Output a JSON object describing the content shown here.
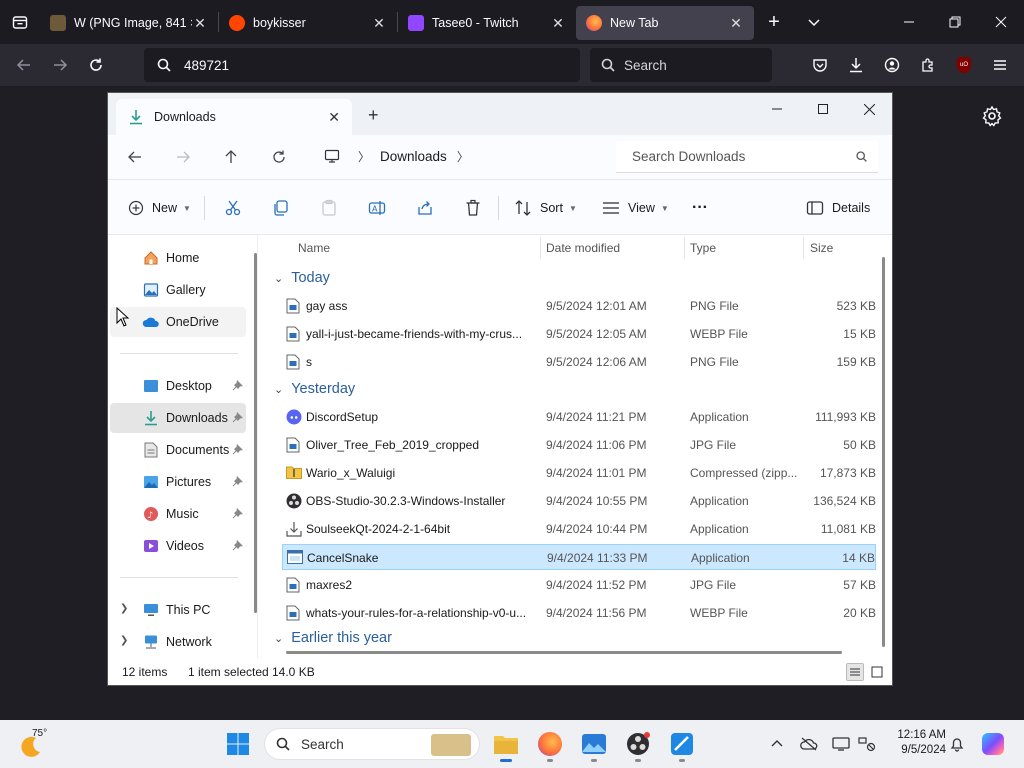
{
  "browser": {
    "tabs": [
      {
        "title": "W (PNG Image, 841 × 7",
        "active": false
      },
      {
        "title": "boykisser",
        "active": false
      },
      {
        "title": "Tasee0 - Twitch",
        "active": false
      },
      {
        "title": "New Tab",
        "active": true
      }
    ],
    "url": "489721",
    "search_placeholder": "Search"
  },
  "explorer": {
    "tab_title": "Downloads",
    "breadcrumb": [
      "Downloads"
    ],
    "search_placeholder": "Search Downloads",
    "commands": {
      "new": "New",
      "sort": "Sort",
      "view": "View",
      "more": "···",
      "details": "Details"
    },
    "nav": {
      "top": [
        {
          "label": "Home",
          "icon": "home-icon"
        },
        {
          "label": "Gallery",
          "icon": "gallery-icon"
        },
        {
          "label": "OneDrive",
          "icon": "onedrive-icon"
        }
      ],
      "pinned": [
        {
          "label": "Desktop",
          "icon": "desktop-icon"
        },
        {
          "label": "Downloads",
          "icon": "download-icon"
        },
        {
          "label": "Documents",
          "icon": "documents-icon"
        },
        {
          "label": "Pictures",
          "icon": "pictures-icon"
        },
        {
          "label": "Music",
          "icon": "music-icon"
        },
        {
          "label": "Videos",
          "icon": "videos-icon"
        }
      ],
      "devices": [
        {
          "label": "This PC",
          "icon": "this-pc-icon"
        },
        {
          "label": "Network",
          "icon": "network-icon"
        }
      ]
    },
    "columns": {
      "name": "Name",
      "date": "Date modified",
      "type": "Type",
      "size": "Size"
    },
    "groups": [
      {
        "label": "Today",
        "files": [
          {
            "name": "gay ass",
            "date": "9/5/2024 12:01 AM",
            "type": "PNG File",
            "size": "523 KB",
            "icon": "file-icon"
          },
          {
            "name": "yall-i-just-became-friends-with-my-crus...",
            "date": "9/5/2024 12:05 AM",
            "type": "WEBP File",
            "size": "15 KB",
            "icon": "file-icon"
          },
          {
            "name": "s",
            "date": "9/5/2024 12:06 AM",
            "type": "PNG File",
            "size": "159 KB",
            "icon": "file-icon"
          }
        ]
      },
      {
        "label": "Yesterday",
        "files": [
          {
            "name": "DiscordSetup",
            "date": "9/4/2024 11:21 PM",
            "type": "Application",
            "size": "111,993 KB",
            "icon": "discord-icon"
          },
          {
            "name": "Oliver_Tree_Feb_2019_cropped",
            "date": "9/4/2024 11:06 PM",
            "type": "JPG File",
            "size": "50 KB",
            "icon": "file-icon"
          },
          {
            "name": "Wario_x_Waluigi",
            "date": "9/4/2024 11:01 PM",
            "type": "Compressed (zipp...",
            "size": "17,873 KB",
            "icon": "zip-folder-icon"
          },
          {
            "name": "OBS-Studio-30.2.3-Windows-Installer",
            "date": "9/4/2024 10:55 PM",
            "type": "Application",
            "size": "136,524 KB",
            "icon": "obs-icon"
          },
          {
            "name": "SoulseekQt-2024-2-1-64bit",
            "date": "9/4/2024 10:44 PM",
            "type": "Application",
            "size": "11,081 KB",
            "icon": "installer-icon"
          },
          {
            "name": "CancelSnake",
            "date": "9/4/2024 11:33 PM",
            "type": "Application",
            "size": "14 KB",
            "icon": "app-icon",
            "selected": true
          },
          {
            "name": "maxres2",
            "date": "9/4/2024 11:52 PM",
            "type": "JPG File",
            "size": "57 KB",
            "icon": "file-icon"
          },
          {
            "name": "whats-your-rules-for-a-relationship-v0-u...",
            "date": "9/4/2024 11:56 PM",
            "type": "WEBP File",
            "size": "20 KB",
            "icon": "file-icon"
          }
        ]
      },
      {
        "label": "Earlier this year",
        "files": []
      }
    ],
    "status": {
      "items": "12 items",
      "selected": "1 item selected",
      "size": "14.0 KB"
    }
  },
  "taskbar": {
    "weather_temp": "75°",
    "search_label": "Search",
    "time": "12:16 AM",
    "date": "9/5/2024"
  }
}
